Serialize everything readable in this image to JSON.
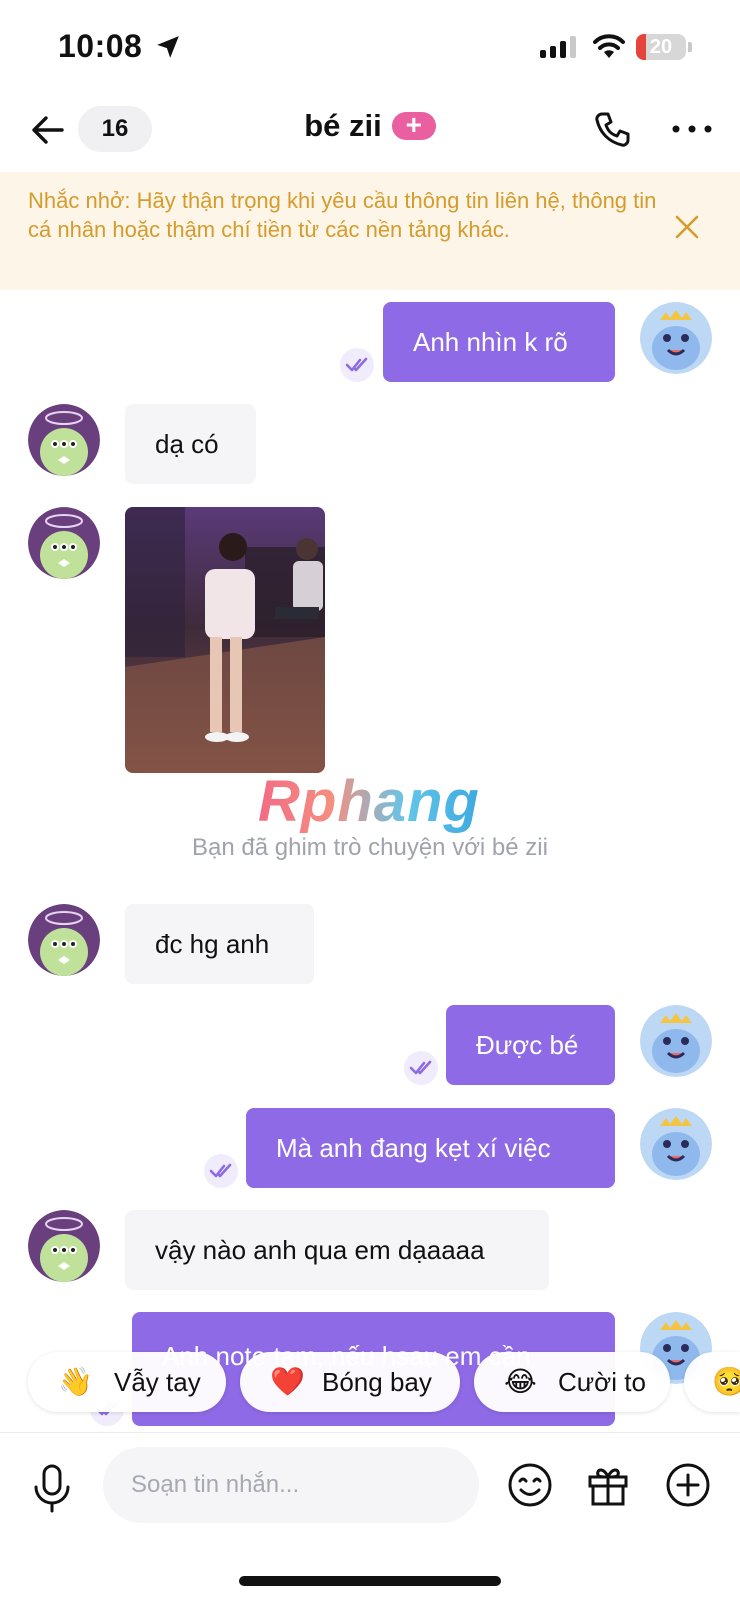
{
  "status_bar": {
    "time": "10:08",
    "battery": "20",
    "battery_level": 0.2,
    "signal_bars": 3
  },
  "header": {
    "unread_count": "16",
    "title": "bé zii",
    "plus_badge": "+"
  },
  "notice": {
    "text": "Nhắc nhở: Hãy thận trọng khi yêu cầu thông tin liên hệ, thông tin cá nhân hoặc thậm chí tiền từ các nền tảng khác."
  },
  "messages": [
    {
      "side": "out",
      "text": "Anh nhìn k rõ",
      "seen": true
    },
    {
      "side": "in",
      "text": "dạ có"
    },
    {
      "side": "in",
      "type": "photo"
    },
    {
      "side": "in",
      "text": "đc hg anh"
    },
    {
      "side": "out",
      "text": "Được bé",
      "seen": true
    },
    {
      "side": "out",
      "text": "Mà anh đang kẹt xí việc",
      "seen": true
    },
    {
      "side": "in",
      "text": "vậy nào anh qua em dạaaaa"
    },
    {
      "side": "out",
      "text": "Anh note tạm, nếu hsau em cần",
      "seen": true
    }
  ],
  "watermark": "Rphang",
  "system_message": "Bạn đã ghim trò chuyện với bé zii",
  "quick_replies": [
    {
      "emoji": "👋",
      "label": "Vẫy tay"
    },
    {
      "emoji": "❤️",
      "label": "Bóng bay"
    },
    {
      "emoji": "😂",
      "label": "Cười to"
    },
    {
      "emoji": "🥺",
      "label": ""
    }
  ],
  "composer": {
    "placeholder": "Soạn tin nhắn..."
  },
  "colors": {
    "accent": "#8e6ae6",
    "incoming_bubble": "#f5f5f7",
    "notice_bg": "#fdf6e8",
    "notice_text": "#d59b2c",
    "badge_pink": "#ea5fa0"
  }
}
